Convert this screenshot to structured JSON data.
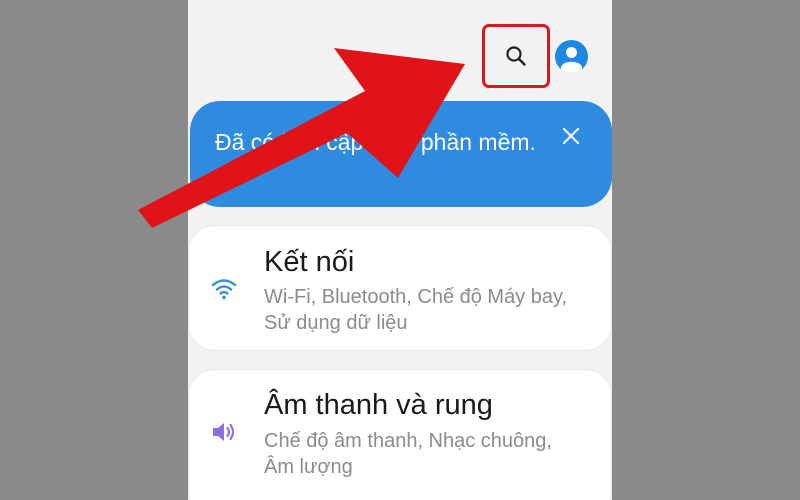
{
  "header": {
    "search_icon": "search-icon",
    "profile_icon": "account-circle-icon"
  },
  "banner": {
    "text": "Đã có bản cập nhật phần mềm.",
    "close_icon": "close-icon"
  },
  "settings": [
    {
      "title": "Kết nối",
      "subtitle": "Wi-Fi, Bluetooth, Chế độ Máy bay, Sử dụng dữ liệu",
      "icon": "wifi-icon",
      "icon_color": "#3a8fe0"
    },
    {
      "title": "Âm thanh và rung",
      "subtitle": "Chế độ âm thanh, Nhạc chuông, Âm lượng",
      "icon": "volume-icon",
      "icon_color": "#8a6fe0"
    }
  ],
  "annotation": {
    "arrow_color": "#d71920",
    "highlight_color": "#d71920"
  }
}
